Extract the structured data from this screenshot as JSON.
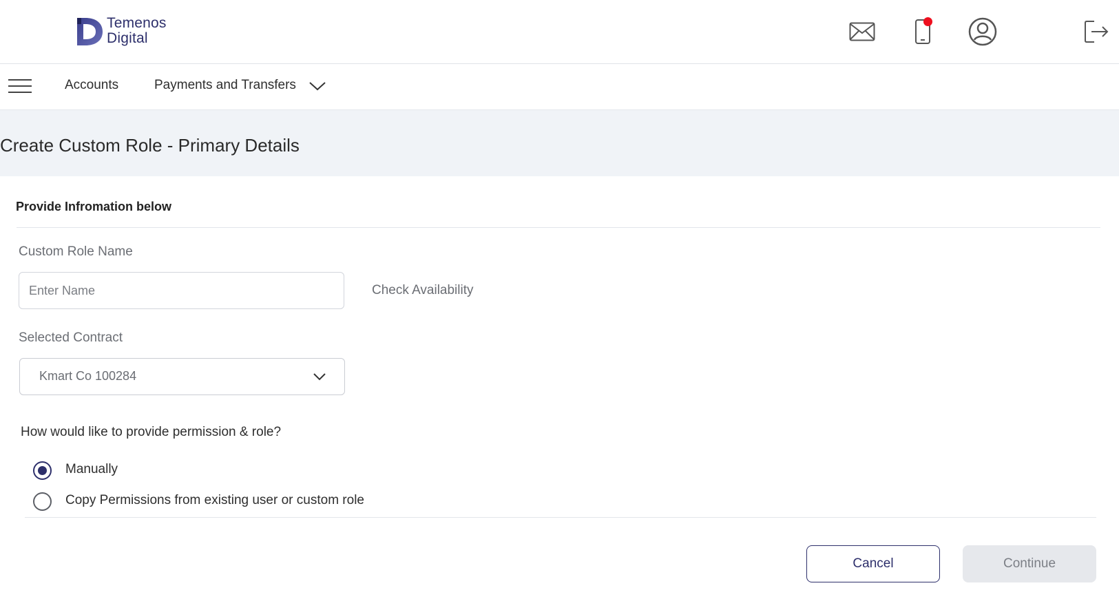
{
  "header": {
    "logo_line1": "Temenos",
    "logo_line2": "Digital",
    "icons": [
      "mail-icon",
      "mobile-icon",
      "user-profile-icon",
      "logout-icon"
    ],
    "notification_color": "#ee0f1e"
  },
  "nav": {
    "menu_icon": "hamburger-menu-icon",
    "items": [
      {
        "label": "Accounts"
      },
      {
        "label": "Payments and Transfers"
      }
    ]
  },
  "page": {
    "title": "Create Custom Role - Primary Details"
  },
  "form": {
    "heading": "Provide Infromation below",
    "role_name_label": "Custom Role Name",
    "role_name_placeholder": "Enter Name",
    "role_name_value": "",
    "check_availability": "Check Availability",
    "contract_label": "Selected Contract",
    "contract_value": "Kmart Co 100284",
    "question": "How would like to provide permission & role?",
    "options": [
      {
        "label": "Manually",
        "selected": true
      },
      {
        "label": "Copy Permissions from existing user or custom role",
        "selected": false
      }
    ],
    "cancel_label": "Cancel",
    "continue_label": "Continue",
    "continue_enabled": false
  },
  "colors": {
    "brand": "#2d2f6b",
    "title_band": "#f0f3f7",
    "disabled_button": "#e6e8ec"
  }
}
